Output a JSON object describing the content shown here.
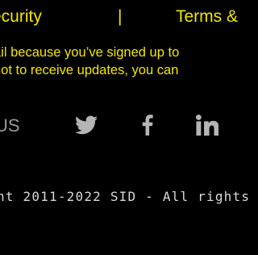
{
  "footer": {
    "links": {
      "security": "ecurity",
      "separator": "|",
      "terms": "Terms &"
    },
    "disclaimer": {
      "line1": "ail because you’ve signed up to",
      "line2": "not to receive updates, you can"
    },
    "social": {
      "label": "US",
      "icons": [
        "twitter-icon",
        "facebook-icon",
        "linkedin-icon"
      ]
    },
    "copyright": "nt 2011-2022 SID - All rights"
  },
  "colors": {
    "background": "#000000",
    "link_yellow": "#f2e600",
    "icon_gray": "#b5b5b5",
    "label_gray": "#9a9a9a",
    "copyright_text": "#d9d9d9"
  }
}
